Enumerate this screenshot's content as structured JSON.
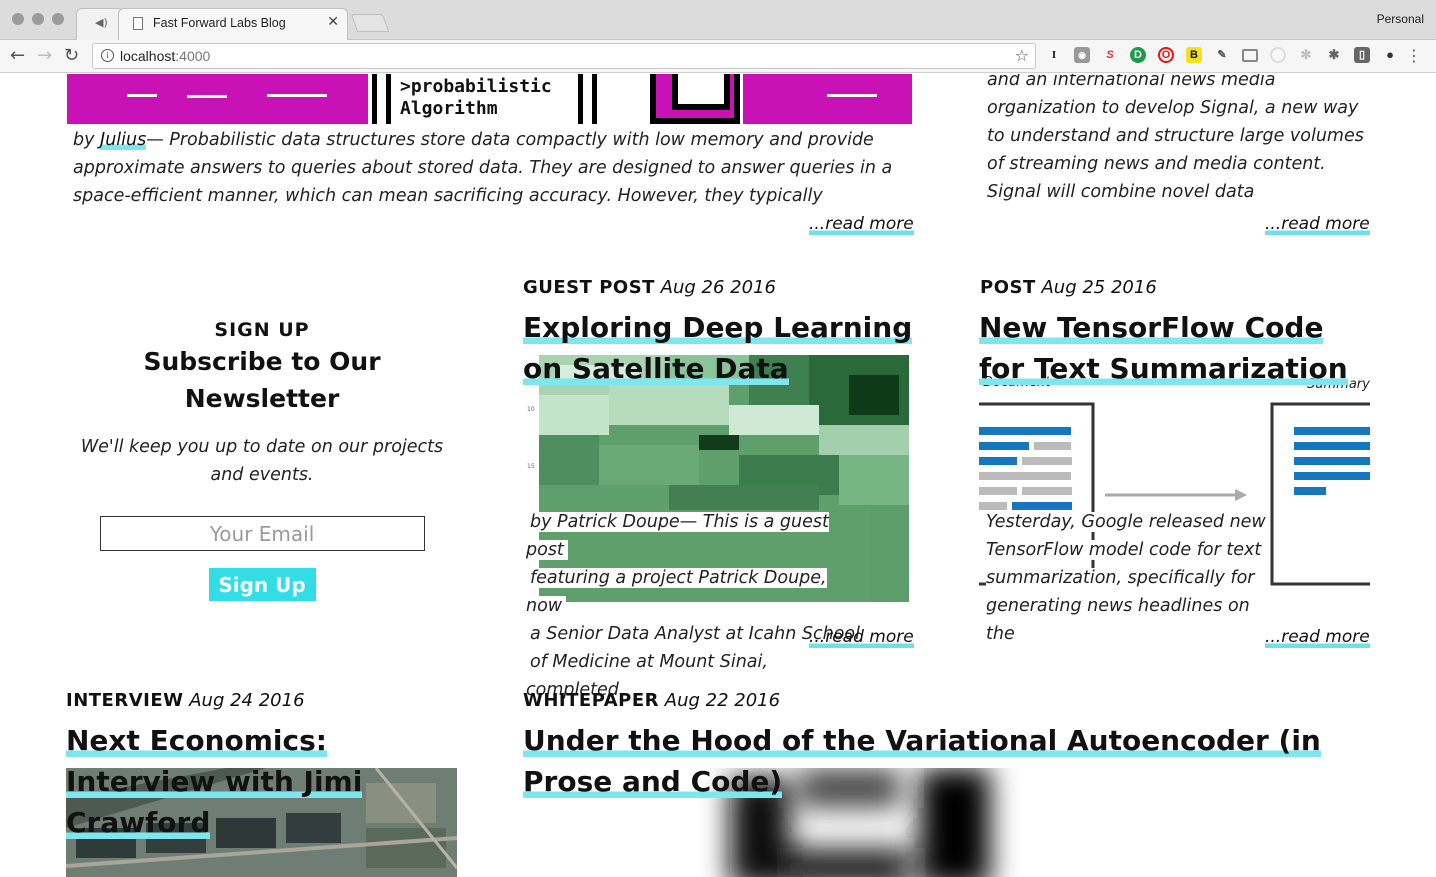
{
  "browser": {
    "tab_title": "Fast Forward Labs Blog",
    "profile": "Personal",
    "url_host": "localhost",
    "url_port": ":4000",
    "nav_back": "←",
    "nav_forward": "→",
    "nav_reload": "↻",
    "tab_close": "✕",
    "audio_icon": "◀)",
    "extensions": [
      "I",
      "camera-icon",
      "S",
      "D",
      "O",
      "B",
      "pin-icon",
      "cast-icon",
      "circle-icon",
      "gear-icon",
      "bug-icon",
      "save-icon",
      "cookie-icon"
    ]
  },
  "top_post": {
    "image_text": ">probabilistic\nAlgorithm",
    "by": "by ",
    "author": "Julius",
    "excerpt": "— Probabilistic data structures store data compactly with low memory and provide approximate answers to queries about stored data. They are designed to answer queries in a space-efficient manner, which can mean sacrificing accuracy. However, they typically",
    "read_more": "...read more"
  },
  "top_right_post": {
    "excerpt": "and an international news media organization to develop Signal, a new way to understand and structure large volumes of streaming news and media content. Signal will combine novel data",
    "read_more": "...read more"
  },
  "signup": {
    "label": "SIGN UP",
    "title": "Subscribe to Our Newsletter",
    "description": "We'll keep you up to date on our projects and events.",
    "email_placeholder": "Your Email",
    "button": "Sign Up"
  },
  "posts": [
    {
      "type": "GUEST POST",
      "date": "Aug 26 2016",
      "title": "Exploring Deep Learning on Satellite Data",
      "excerpt_lines": [
        "by Patrick Doupe— This is a guest post",
        "featuring a project Patrick Doupe, now",
        "a Senior Data Analyst at Icahn School",
        "of Medicine at Mount Sinai, completed"
      ],
      "axis_ticks": [
        "10",
        "15"
      ],
      "read_more": "...read more"
    },
    {
      "type": "POST",
      "date": "Aug 25 2016",
      "title": "New TensorFlow Code for Text Summarization",
      "diagram_labels": [
        "Document",
        "Summary"
      ],
      "excerpt_lines": [
        "Yesterday, Google released new",
        "TensorFlow model code for text",
        "summarization, specifically for",
        "generating news headlines on the"
      ],
      "read_more": "...read more"
    },
    {
      "type": "INTERVIEW",
      "date": "Aug 24 2016",
      "title": "Next Economics: Interview with Jimi Crawford"
    },
    {
      "type": "WHITEPAPER",
      "date": "Aug 22 2016",
      "title": "Under the Hood of the Variational Autoencoder (in Prose and Code)"
    }
  ],
  "colors": {
    "accent_underline": "#7ee6ee",
    "signup_button": "#33dde6",
    "magenta": "#c812b6"
  }
}
